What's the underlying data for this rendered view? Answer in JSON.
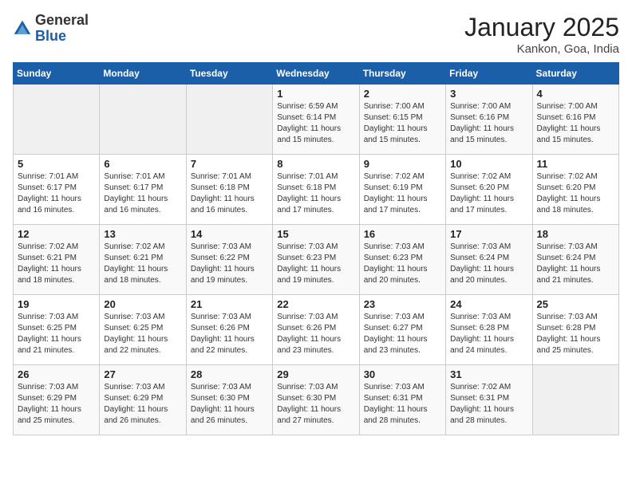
{
  "header": {
    "logo_general": "General",
    "logo_blue": "Blue",
    "month": "January 2025",
    "location": "Kankon, Goa, India"
  },
  "days_of_week": [
    "Sunday",
    "Monday",
    "Tuesday",
    "Wednesday",
    "Thursday",
    "Friday",
    "Saturday"
  ],
  "weeks": [
    [
      {
        "day": "",
        "info": ""
      },
      {
        "day": "",
        "info": ""
      },
      {
        "day": "",
        "info": ""
      },
      {
        "day": "1",
        "info": "Sunrise: 6:59 AM\nSunset: 6:14 PM\nDaylight: 11 hours and 15 minutes."
      },
      {
        "day": "2",
        "info": "Sunrise: 7:00 AM\nSunset: 6:15 PM\nDaylight: 11 hours and 15 minutes."
      },
      {
        "day": "3",
        "info": "Sunrise: 7:00 AM\nSunset: 6:16 PM\nDaylight: 11 hours and 15 minutes."
      },
      {
        "day": "4",
        "info": "Sunrise: 7:00 AM\nSunset: 6:16 PM\nDaylight: 11 hours and 15 minutes."
      }
    ],
    [
      {
        "day": "5",
        "info": "Sunrise: 7:01 AM\nSunset: 6:17 PM\nDaylight: 11 hours and 16 minutes."
      },
      {
        "day": "6",
        "info": "Sunrise: 7:01 AM\nSunset: 6:17 PM\nDaylight: 11 hours and 16 minutes."
      },
      {
        "day": "7",
        "info": "Sunrise: 7:01 AM\nSunset: 6:18 PM\nDaylight: 11 hours and 16 minutes."
      },
      {
        "day": "8",
        "info": "Sunrise: 7:01 AM\nSunset: 6:18 PM\nDaylight: 11 hours and 17 minutes."
      },
      {
        "day": "9",
        "info": "Sunrise: 7:02 AM\nSunset: 6:19 PM\nDaylight: 11 hours and 17 minutes."
      },
      {
        "day": "10",
        "info": "Sunrise: 7:02 AM\nSunset: 6:20 PM\nDaylight: 11 hours and 17 minutes."
      },
      {
        "day": "11",
        "info": "Sunrise: 7:02 AM\nSunset: 6:20 PM\nDaylight: 11 hours and 18 minutes."
      }
    ],
    [
      {
        "day": "12",
        "info": "Sunrise: 7:02 AM\nSunset: 6:21 PM\nDaylight: 11 hours and 18 minutes."
      },
      {
        "day": "13",
        "info": "Sunrise: 7:02 AM\nSunset: 6:21 PM\nDaylight: 11 hours and 18 minutes."
      },
      {
        "day": "14",
        "info": "Sunrise: 7:03 AM\nSunset: 6:22 PM\nDaylight: 11 hours and 19 minutes."
      },
      {
        "day": "15",
        "info": "Sunrise: 7:03 AM\nSunset: 6:23 PM\nDaylight: 11 hours and 19 minutes."
      },
      {
        "day": "16",
        "info": "Sunrise: 7:03 AM\nSunset: 6:23 PM\nDaylight: 11 hours and 20 minutes."
      },
      {
        "day": "17",
        "info": "Sunrise: 7:03 AM\nSunset: 6:24 PM\nDaylight: 11 hours and 20 minutes."
      },
      {
        "day": "18",
        "info": "Sunrise: 7:03 AM\nSunset: 6:24 PM\nDaylight: 11 hours and 21 minutes."
      }
    ],
    [
      {
        "day": "19",
        "info": "Sunrise: 7:03 AM\nSunset: 6:25 PM\nDaylight: 11 hours and 21 minutes."
      },
      {
        "day": "20",
        "info": "Sunrise: 7:03 AM\nSunset: 6:25 PM\nDaylight: 11 hours and 22 minutes."
      },
      {
        "day": "21",
        "info": "Sunrise: 7:03 AM\nSunset: 6:26 PM\nDaylight: 11 hours and 22 minutes."
      },
      {
        "day": "22",
        "info": "Sunrise: 7:03 AM\nSunset: 6:26 PM\nDaylight: 11 hours and 23 minutes."
      },
      {
        "day": "23",
        "info": "Sunrise: 7:03 AM\nSunset: 6:27 PM\nDaylight: 11 hours and 23 minutes."
      },
      {
        "day": "24",
        "info": "Sunrise: 7:03 AM\nSunset: 6:28 PM\nDaylight: 11 hours and 24 minutes."
      },
      {
        "day": "25",
        "info": "Sunrise: 7:03 AM\nSunset: 6:28 PM\nDaylight: 11 hours and 25 minutes."
      }
    ],
    [
      {
        "day": "26",
        "info": "Sunrise: 7:03 AM\nSunset: 6:29 PM\nDaylight: 11 hours and 25 minutes."
      },
      {
        "day": "27",
        "info": "Sunrise: 7:03 AM\nSunset: 6:29 PM\nDaylight: 11 hours and 26 minutes."
      },
      {
        "day": "28",
        "info": "Sunrise: 7:03 AM\nSunset: 6:30 PM\nDaylight: 11 hours and 26 minutes."
      },
      {
        "day": "29",
        "info": "Sunrise: 7:03 AM\nSunset: 6:30 PM\nDaylight: 11 hours and 27 minutes."
      },
      {
        "day": "30",
        "info": "Sunrise: 7:03 AM\nSunset: 6:31 PM\nDaylight: 11 hours and 28 minutes."
      },
      {
        "day": "31",
        "info": "Sunrise: 7:02 AM\nSunset: 6:31 PM\nDaylight: 11 hours and 28 minutes."
      },
      {
        "day": "",
        "info": ""
      }
    ]
  ]
}
